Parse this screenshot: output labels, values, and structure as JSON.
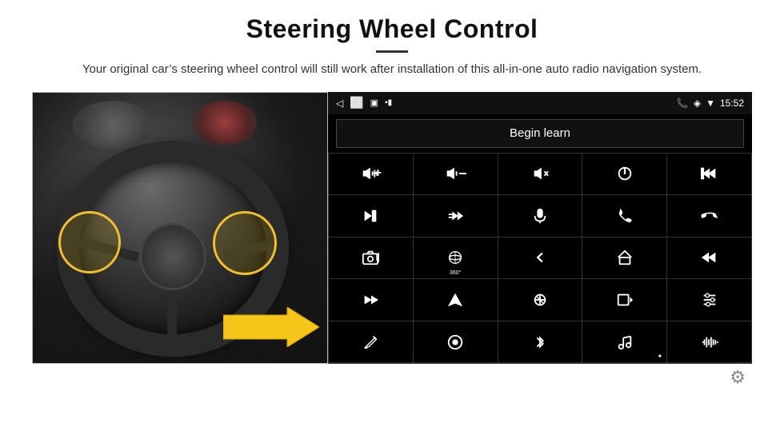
{
  "page": {
    "title": "Steering Wheel Control",
    "subtitle": "Your original car’s steering wheel control will still work after installation of this all-in-one auto radio navigation system."
  },
  "status_bar": {
    "back_icon": "◁",
    "rect_icon": "▭",
    "square_icon": "▢",
    "signal_icon": "▪▪",
    "phone_icon": "📞",
    "location_icon": "◈",
    "wifi_icon": "▼",
    "time": "15:52"
  },
  "begin_learn": {
    "label": "Begin learn"
  },
  "controls": [
    {
      "id": "vol-up",
      "icon": "vol_up"
    },
    {
      "id": "vol-down",
      "icon": "vol_down"
    },
    {
      "id": "vol-mute",
      "icon": "vol_mute"
    },
    {
      "id": "power",
      "icon": "power"
    },
    {
      "id": "prev-track",
      "icon": "prev_track"
    },
    {
      "id": "next",
      "icon": "next"
    },
    {
      "id": "ff",
      "icon": "ff"
    },
    {
      "id": "mic",
      "icon": "mic"
    },
    {
      "id": "phone",
      "icon": "phone"
    },
    {
      "id": "hang-up",
      "icon": "hang_up"
    },
    {
      "id": "cam",
      "icon": "cam"
    },
    {
      "id": "360",
      "icon": "360"
    },
    {
      "id": "back",
      "icon": "back"
    },
    {
      "id": "home",
      "icon": "home"
    },
    {
      "id": "skip-back",
      "icon": "skip_back"
    },
    {
      "id": "fast-fwd",
      "icon": "fast_fwd"
    },
    {
      "id": "nav",
      "icon": "nav"
    },
    {
      "id": "eq",
      "icon": "eq"
    },
    {
      "id": "rec",
      "icon": "rec"
    },
    {
      "id": "sliders",
      "icon": "sliders"
    },
    {
      "id": "pen",
      "icon": "pen"
    },
    {
      "id": "circle-dot",
      "icon": "circle_dot"
    },
    {
      "id": "bluetooth",
      "icon": "bluetooth"
    },
    {
      "id": "music",
      "icon": "music"
    },
    {
      "id": "waveform",
      "icon": "waveform"
    }
  ]
}
